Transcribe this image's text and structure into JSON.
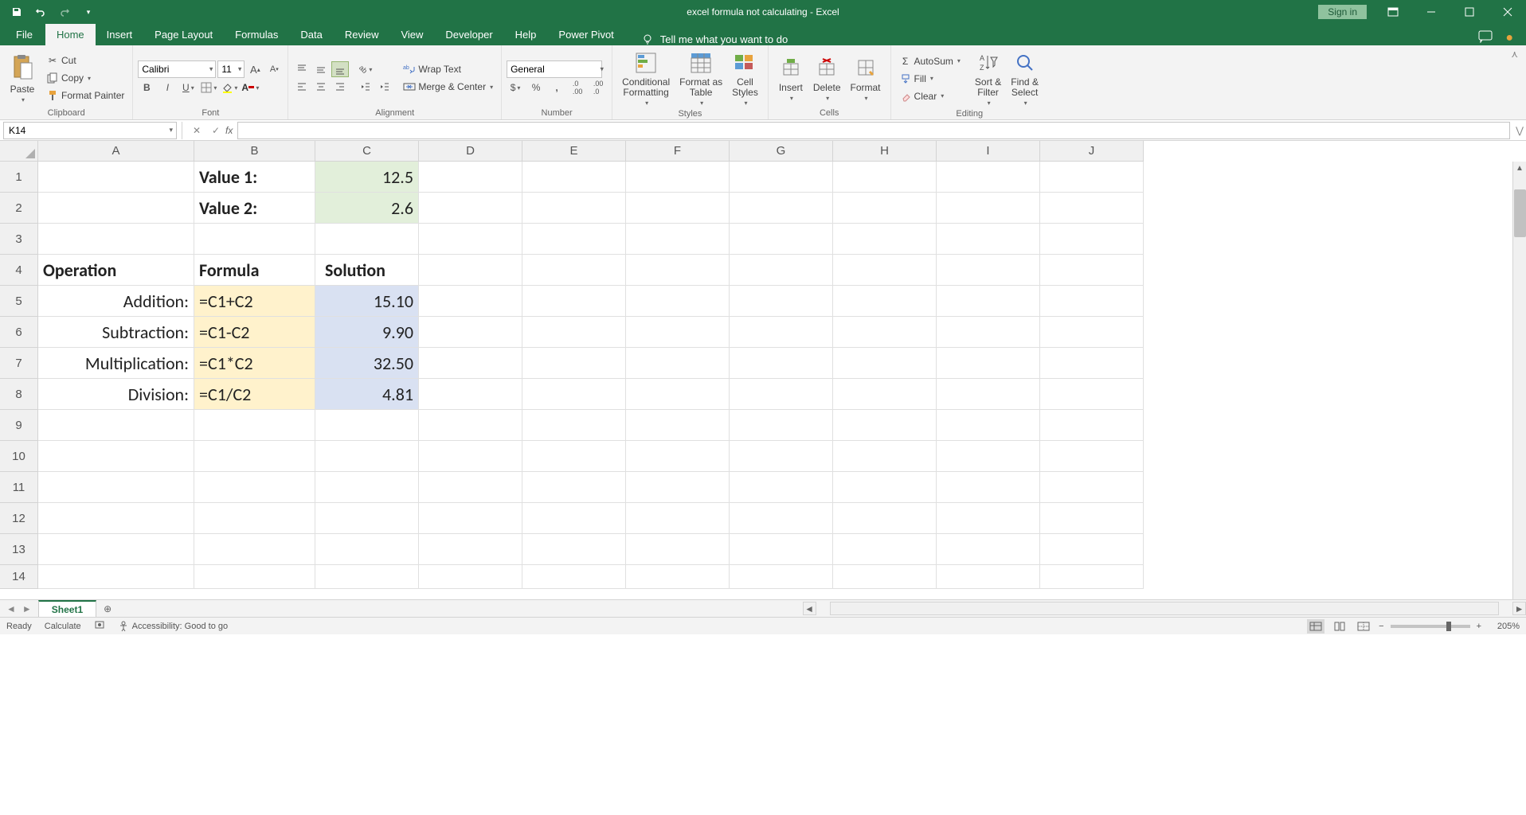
{
  "title": "excel formula not calculating  -  Excel",
  "signin": "Sign in",
  "tabs": {
    "file": "File",
    "home": "Home",
    "insert": "Insert",
    "pagelayout": "Page Layout",
    "formulas": "Formulas",
    "data": "Data",
    "review": "Review",
    "view": "View",
    "developer": "Developer",
    "help": "Help",
    "powerpivot": "Power Pivot"
  },
  "tellme": "Tell me what you want to do",
  "clipboard": {
    "paste": "Paste",
    "cut": "Cut",
    "copy": "Copy",
    "painter": "Format Painter",
    "label": "Clipboard"
  },
  "font": {
    "name": "Calibri",
    "size": "11",
    "label": "Font"
  },
  "alignment": {
    "wrap": "Wrap Text",
    "merge": "Merge & Center",
    "label": "Alignment"
  },
  "number": {
    "format": "General",
    "label": "Number"
  },
  "styles": {
    "cond": "Conditional Formatting",
    "table": "Format as Table",
    "cell": "Cell Styles",
    "label": "Styles"
  },
  "cells": {
    "insert": "Insert",
    "delete": "Delete",
    "format": "Format",
    "label": "Cells"
  },
  "editing": {
    "autosum": "AutoSum",
    "fill": "Fill",
    "clear": "Clear",
    "sort": "Sort & Filter",
    "find": "Find & Select",
    "label": "Editing"
  },
  "namebox": "K14",
  "formula": "",
  "cols": [
    "A",
    "B",
    "C",
    "D",
    "E",
    "F",
    "G",
    "H",
    "I",
    "J"
  ],
  "rows": [
    "1",
    "2",
    "3",
    "4",
    "5",
    "6",
    "7",
    "8",
    "9",
    "10",
    "11",
    "12",
    "13",
    "14"
  ],
  "data": {
    "B1": "Value 1:",
    "C1": "12.5",
    "B2": "Value 2:",
    "C2": "2.6",
    "A4": "Operation",
    "B4": "Formula",
    "C4": "Solution",
    "A5": "Addition:",
    "B5": "=C1+C2",
    "C5": "15.10",
    "A6": "Subtraction:",
    "B6": "=C1-C2",
    "C6": "9.90",
    "A7": "Multiplication:",
    "B7": "=C1*C2",
    "C7": "32.50",
    "A8": "Division:",
    "B8": "=C1/C2",
    "C8": "4.81"
  },
  "sheet": "Sheet1",
  "status": {
    "ready": "Ready",
    "calc": "Calculate",
    "access": "Accessibility: Good to go"
  },
  "zoom": "205%"
}
